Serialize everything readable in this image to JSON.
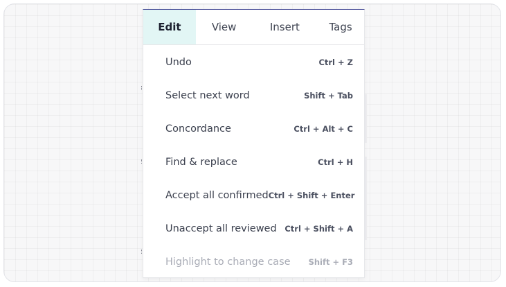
{
  "menu": {
    "tabs": [
      {
        "label": "Edit",
        "active": true
      },
      {
        "label": "View",
        "active": false
      },
      {
        "label": "Insert",
        "active": false
      },
      {
        "label": "Tags",
        "active": false
      }
    ],
    "items": [
      {
        "label": "Undo",
        "shortcut": "Ctrl + Z",
        "disabled": false
      },
      {
        "label": "Select next word",
        "shortcut": "Shift + Tab",
        "disabled": false
      },
      {
        "label": "Concordance",
        "shortcut": "Ctrl + Alt + C",
        "disabled": false
      },
      {
        "label": "Find & replace",
        "shortcut": "Ctrl + H",
        "disabled": false
      },
      {
        "label": "Accept all confirmed",
        "shortcut": "Ctrl + Shift + Enter",
        "disabled": false
      },
      {
        "label": "Unaccept all reviewed",
        "shortcut": "Ctrl + Shift + A",
        "disabled": false
      },
      {
        "label": "Highlight to change case",
        "shortcut": "Shift + F3",
        "disabled": true
      }
    ]
  },
  "colors": {
    "active_tab_bg": "#e2f6f5",
    "menu_top_border": "#3a3f8f",
    "disabled_text": "#a9acb6"
  }
}
